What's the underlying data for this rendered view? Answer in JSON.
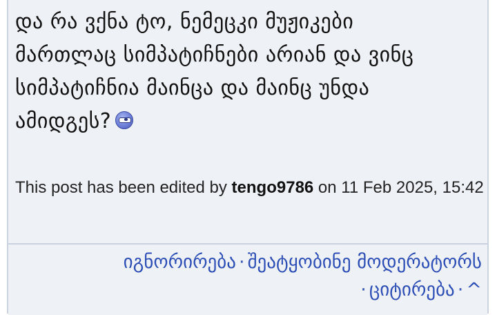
{
  "post": {
    "lines": [
      "და რა ვქნა ტო, ნემეცკი მუჟიკები",
      "მართლაც სიმპატიჩნები არიან და ვინც",
      "სიმპატიჩნია მაინცა და მაინც უნდა",
      "ამიდგეს?"
    ],
    "emoticon_icon": "blindfold-emoticon",
    "edit_note": {
      "prefix": "This post has been edited by ",
      "editor": "tengo9786",
      "suffix": " on 11 Feb 2025, 15:42"
    }
  },
  "actions": {
    "ignore": "იგნორირება",
    "report": "შეატყობინე მოდერატორს",
    "quote": "ციტირება",
    "up": "^",
    "separator": "·"
  },
  "colors": {
    "background": "#eef1f6",
    "border": "#c9d2de",
    "link": "#2d4fb5",
    "text": "#111111"
  }
}
